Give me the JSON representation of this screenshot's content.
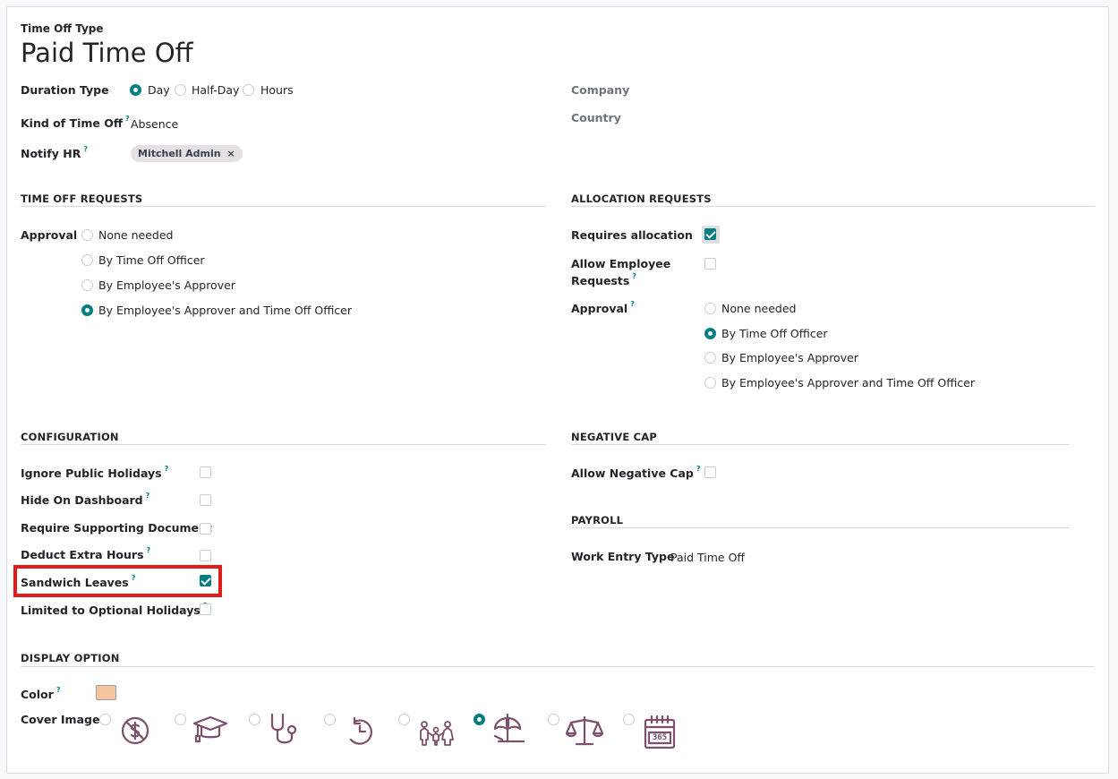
{
  "header": {
    "caption": "Time Off Type",
    "title": "Paid Time Off"
  },
  "top": {
    "duration_label": "Duration Type",
    "duration_options": [
      "Day",
      "Half-Day",
      "Hours"
    ],
    "duration_selected": "Day",
    "kind_label": "Kind of Time Off",
    "kind_value": "Absence",
    "notify_label": "Notify HR",
    "notify_tag": "Mitchell Admin",
    "tag_remove": "×",
    "company_label": "Company",
    "country_label": "Country",
    "help_mark": "?"
  },
  "time_off_requests": {
    "title": "TIME OFF REQUESTS",
    "approval_label": "Approval",
    "options": [
      "None needed",
      "By Time Off Officer",
      "By Employee's Approver",
      "By Employee's Approver and Time Off Officer"
    ],
    "selected": "By Employee's Approver and Time Off Officer"
  },
  "allocation_requests": {
    "title": "ALLOCATION REQUESTS",
    "requires_label": "Requires allocation",
    "requires_checked": true,
    "allow_label_1": "Allow Employee",
    "allow_label_2": "Requests",
    "allow_checked": false,
    "approval_label": "Approval",
    "options": [
      "None needed",
      "By Time Off Officer",
      "By Employee's Approver",
      "By Employee's Approver and Time Off Officer"
    ],
    "selected": "By Time Off Officer"
  },
  "configuration": {
    "title": "CONFIGURATION",
    "items": [
      {
        "label": "Ignore Public Holidays",
        "help": true,
        "checked": false
      },
      {
        "label": "Hide On Dashboard",
        "help": true,
        "checked": false
      },
      {
        "label": "Require Supporting Document",
        "help": false,
        "checked": false
      },
      {
        "label": "Deduct Extra Hours",
        "help": true,
        "checked": false
      },
      {
        "label": "Sandwich Leaves",
        "help": true,
        "checked": true,
        "highlighted": true
      },
      {
        "label": "Limited to Optional Holidays",
        "help": true,
        "checked": false
      }
    ],
    "highlight_color": "#e41b1b"
  },
  "negative_cap": {
    "title": "NEGATIVE CAP",
    "label": "Allow Negative Cap",
    "checked": false
  },
  "payroll": {
    "title": "PAYROLL",
    "label": "Work Entry Type",
    "value": "Paid Time Off"
  },
  "display_option": {
    "title": "DISPLAY OPTION",
    "color_label": "Color",
    "color_value": "#f4c59c",
    "cover_label": "Cover Image",
    "cover_icons": [
      "money-icon",
      "graduation-cap-icon",
      "stethoscope-icon",
      "history-icon",
      "family-icon",
      "beach-umbrella-icon",
      "balance-scale-icon",
      "calendar-365-icon"
    ],
    "cover_selected": "beach-umbrella-icon",
    "calendar_text": "365"
  },
  "colors": {
    "accent": "#017e84",
    "icon": "#7c4f6c"
  }
}
